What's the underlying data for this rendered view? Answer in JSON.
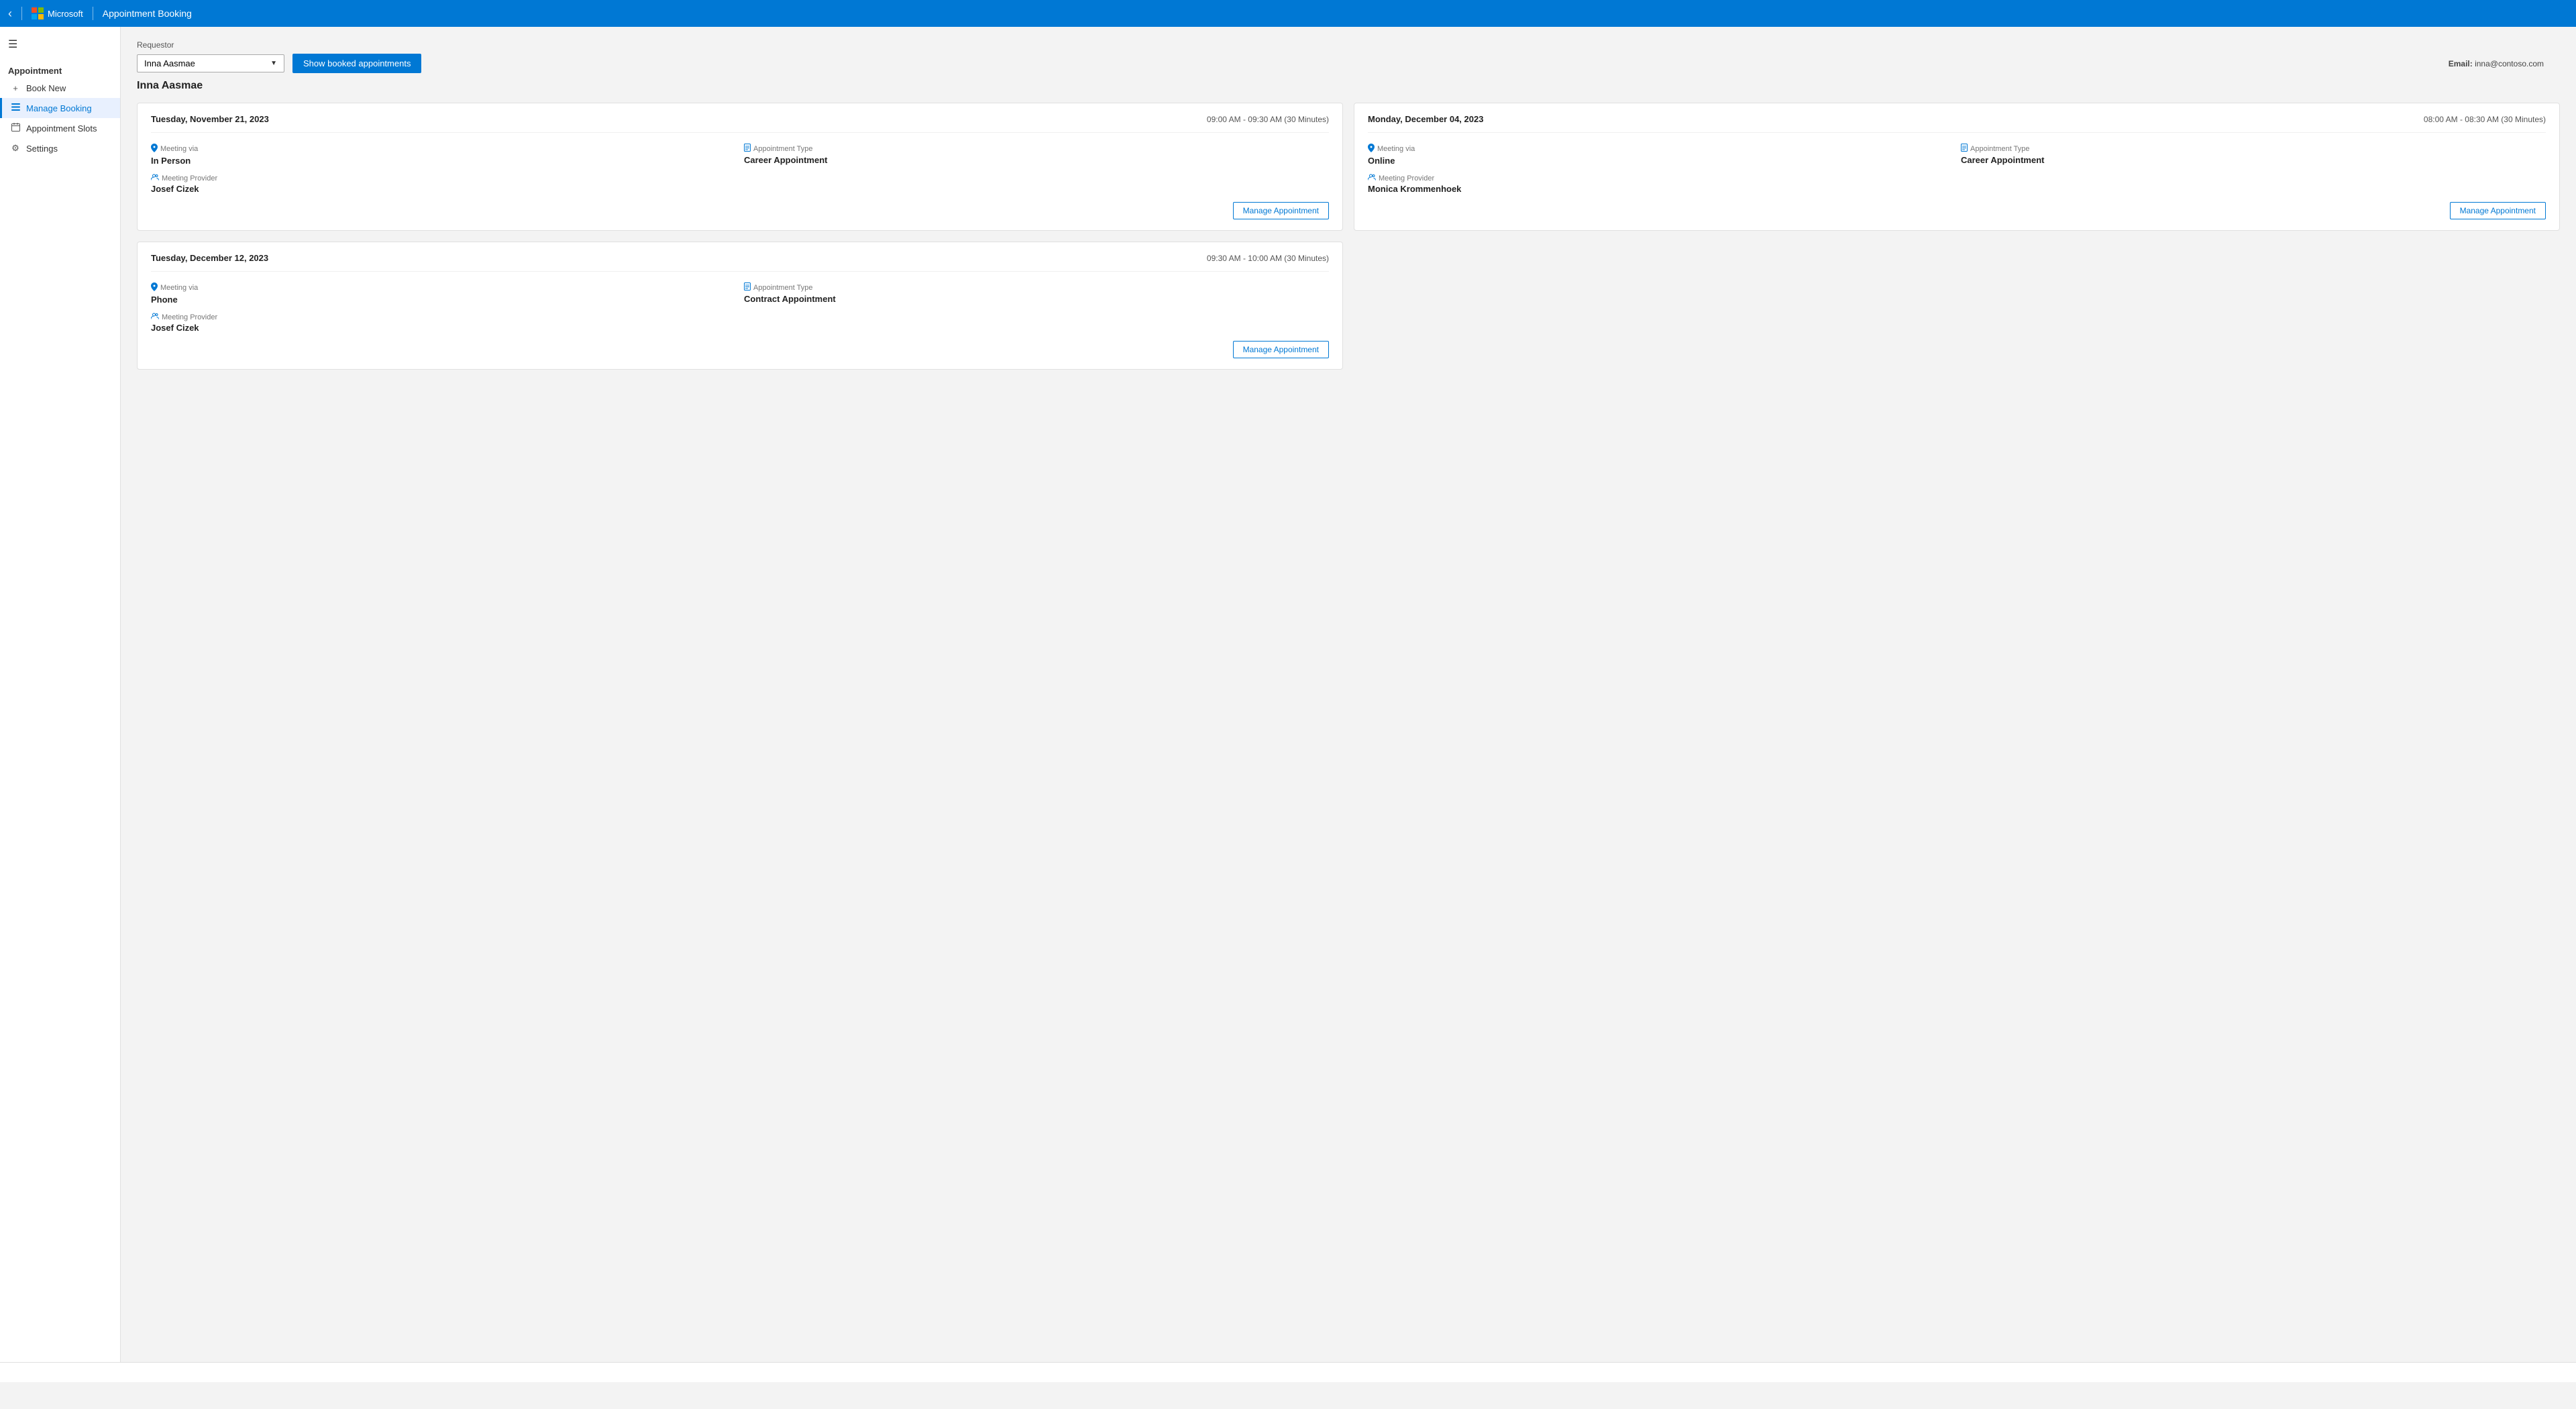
{
  "topbar": {
    "app_name": "Appointment Booking",
    "back_label": "‹"
  },
  "sidebar": {
    "hamburger_icon": "☰",
    "section_title": "Appointment",
    "items": [
      {
        "id": "book-new",
        "label": "Book New",
        "icon": "＋",
        "active": false
      },
      {
        "id": "manage-booking",
        "label": "Manage Booking",
        "icon": "☰",
        "active": true
      },
      {
        "id": "appointment-slots",
        "label": "Appointment Slots",
        "icon": "☐",
        "active": false
      },
      {
        "id": "settings",
        "label": "Settings",
        "icon": "⚙",
        "active": false
      }
    ]
  },
  "main": {
    "requestor_label": "Requestor",
    "requestor_name": "Inna Aasmae",
    "requestor_select_value": "Inna Aasmae",
    "show_booked_label": "Show booked appointments",
    "email_label": "Email:",
    "email_value": "inna@contoso.com",
    "appointments": [
      {
        "id": "appt-1",
        "date": "Tuesday, November 21, 2023",
        "time": "09:00 AM - 09:30 AM (30 Minutes)",
        "meeting_via_label": "Meeting via",
        "meeting_via": "In Person",
        "appt_type_label": "Appointment Type",
        "appt_type": "Career Appointment",
        "provider_label": "Meeting Provider",
        "provider": "Josef Cizek",
        "manage_label": "Manage Appointment"
      },
      {
        "id": "appt-2",
        "date": "Monday, December 04, 2023",
        "time": "08:00 AM - 08:30 AM (30 Minutes)",
        "meeting_via_label": "Meeting via",
        "meeting_via": "Online",
        "appt_type_label": "Appointment Type",
        "appt_type": "Career Appointment",
        "provider_label": "Meeting Provider",
        "provider": "Monica Krommenhoek",
        "manage_label": "Manage Appointment"
      },
      {
        "id": "appt-3",
        "date": "Tuesday, December 12, 2023",
        "time": "09:30 AM - 10:00 AM (30 Minutes)",
        "meeting_via_label": "Meeting via",
        "meeting_via": "Phone",
        "appt_type_label": "Appointment Type",
        "appt_type": "Contract Appointment",
        "provider_label": "Meeting Provider",
        "provider": "Josef Cizek",
        "manage_label": "Manage Appointment"
      }
    ]
  },
  "icons": {
    "location": "📍",
    "document": "📄",
    "people": "👥",
    "chevron_down": "▼"
  }
}
